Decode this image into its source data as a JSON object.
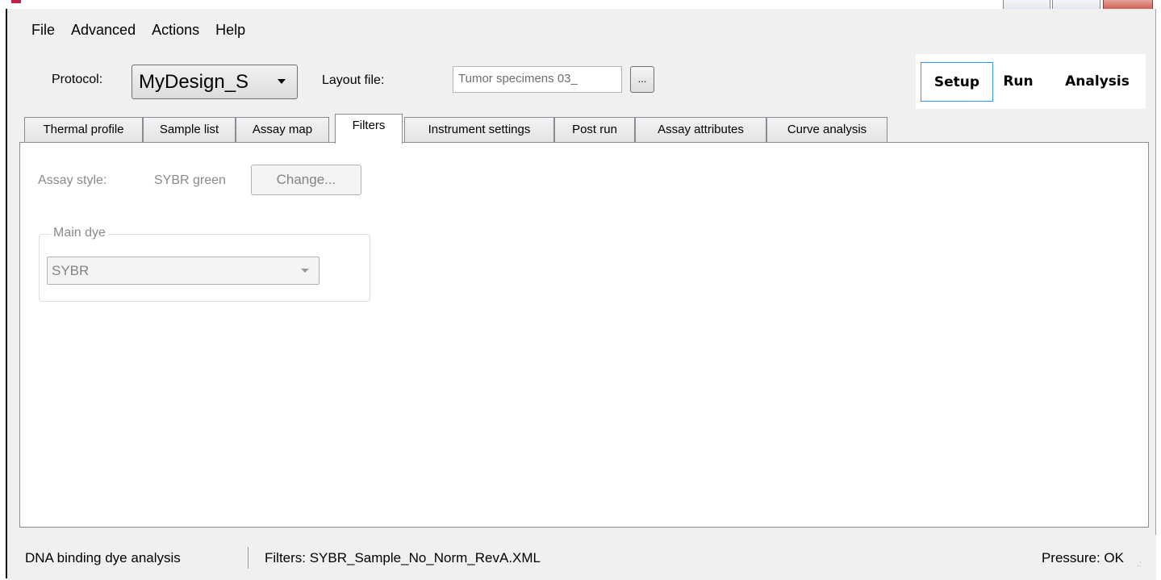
{
  "menu": [
    "File",
    "Advanced",
    "Actions",
    "Help"
  ],
  "toolbar": {
    "protocol_label": "Protocol:",
    "protocol_value": "MyDesign_S",
    "layout_label": "Layout file:",
    "layout_value": "Tumor specimens 03_",
    "browse_label": "..."
  },
  "modes": {
    "setup": "Setup",
    "run": "Run",
    "analysis": "Analysis",
    "active": "Setup"
  },
  "tabs": [
    "Thermal profile",
    "Sample list",
    "Assay map",
    "Filters",
    "Instrument settings",
    "Post run",
    "Assay attributes",
    "Curve analysis"
  ],
  "active_tab": "Filters",
  "filters": {
    "assay_style_label": "Assay style:",
    "assay_style_value": "SYBR green",
    "change_label": "Change...",
    "main_dye_legend": "Main dye",
    "main_dye_value": "SYBR"
  },
  "status": {
    "analysis": "DNA binding dye analysis",
    "filters_file": "Filters: SYBR_Sample_No_Norm_RevA.XML",
    "pressure": "Pressure: OK"
  },
  "colors": {
    "window_bg": "#f0f0f0",
    "focus_border": "#3399ff",
    "disabled_text": "#8a8a8a",
    "close_button": "#c74a3e"
  }
}
